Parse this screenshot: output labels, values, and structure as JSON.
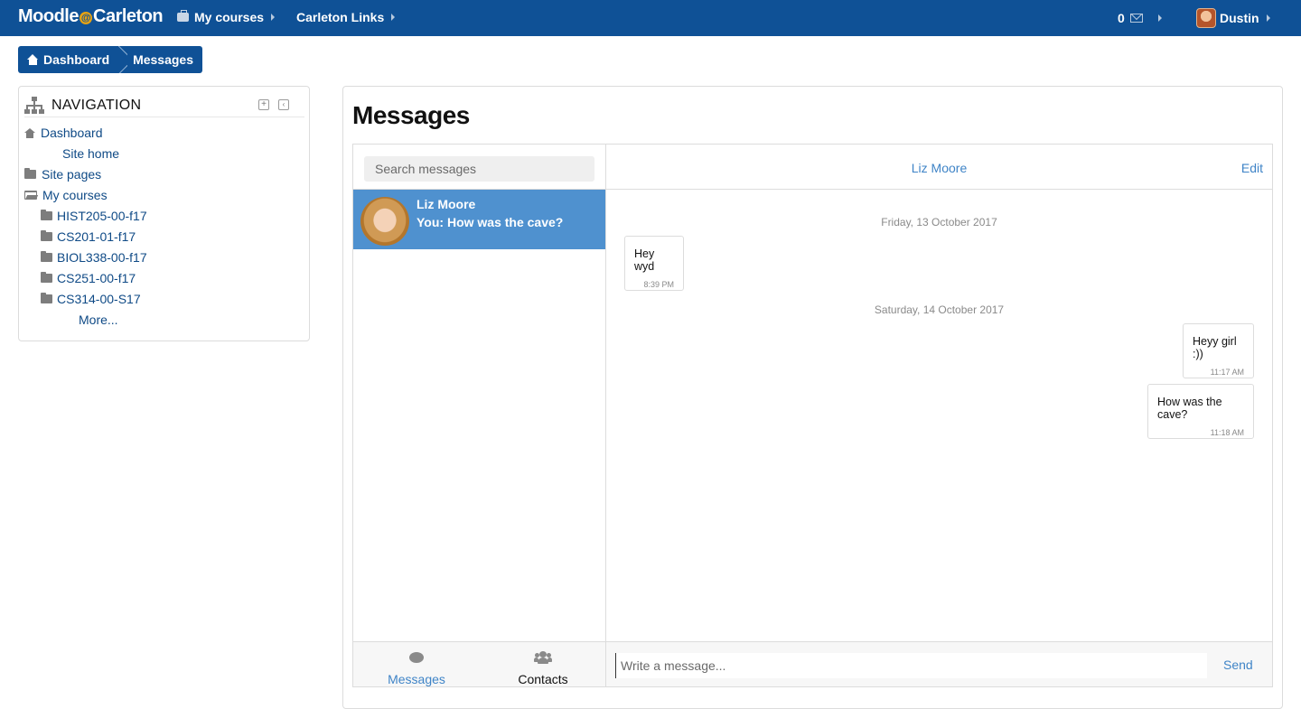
{
  "navbar": {
    "brand_left": "Moodle",
    "brand_at": "@",
    "brand_right": "Carleton",
    "my_courses": "My courses",
    "carleton_links": "Carleton Links",
    "message_count": "0",
    "user_name": "Dustin"
  },
  "breadcrumb": {
    "items": [
      "Dashboard",
      "Messages"
    ]
  },
  "navigation": {
    "title": "NAVIGATION",
    "items": [
      {
        "label": "Dashboard",
        "icon": "home-icon"
      },
      {
        "label": "Site home"
      },
      {
        "label": "Site pages",
        "icon": "folder-icon"
      },
      {
        "label": "My courses",
        "icon": "folder-open-icon"
      },
      {
        "label": "HIST205-00-f17",
        "icon": "folder-icon"
      },
      {
        "label": "CS201-01-f17",
        "icon": "folder-icon"
      },
      {
        "label": "BIOL338-00-f17",
        "icon": "folder-icon"
      },
      {
        "label": "CS251-00-f17",
        "icon": "folder-icon"
      },
      {
        "label": "CS314-00-S17",
        "icon": "folder-icon"
      },
      {
        "label": "More..."
      }
    ]
  },
  "page": {
    "title": "Messages"
  },
  "messages_app": {
    "search_placeholder": "Search messages",
    "conversation": {
      "name": "Liz Moore",
      "preview": "You: How was the cave?"
    },
    "tabs": {
      "messages": "Messages",
      "contacts": "Contacts"
    },
    "chat": {
      "contact_name": "Liz Moore",
      "edit_label": "Edit",
      "days": [
        {
          "label": "Friday, 13 October 2017"
        },
        {
          "label": "Saturday, 14 October 2017"
        }
      ],
      "messages": [
        {
          "text": "Hey wyd",
          "time": "8:39 PM",
          "side": "received"
        },
        {
          "text": "Heyy girl :))",
          "time": "11:17 AM",
          "side": "sent"
        },
        {
          "text": "How was the cave?",
          "time": "11:18 AM",
          "side": "sent"
        }
      ],
      "compose_placeholder": "Write a message...",
      "send_label": "Send"
    }
  },
  "colors": {
    "brand": "#0f5196",
    "accent": "#3f84c7",
    "selected": "#4f91cf"
  }
}
